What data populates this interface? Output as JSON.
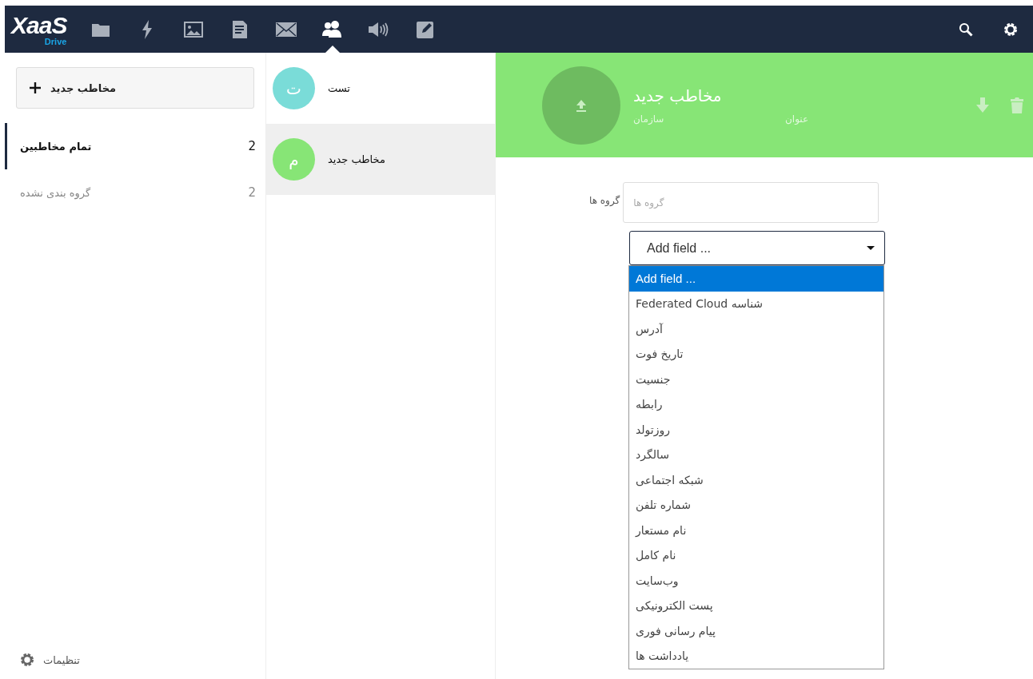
{
  "header": {
    "logo": "XaaS",
    "logo_sub": "Drive",
    "apps": [
      {
        "kind": "folder",
        "selected": false
      },
      {
        "kind": "activity",
        "selected": false
      },
      {
        "kind": "gallery",
        "selected": false
      },
      {
        "kind": "document",
        "selected": false
      },
      {
        "kind": "mail",
        "selected": false
      },
      {
        "kind": "contacts",
        "selected": true
      },
      {
        "kind": "audio",
        "selected": false
      },
      {
        "kind": "notes",
        "selected": false
      }
    ],
    "actions": [
      {
        "kind": "search"
      },
      {
        "kind": "settings"
      }
    ]
  },
  "sidebar": {
    "new_button": "مخاطب جدید",
    "groups": [
      {
        "label": "تمام مخاطبین",
        "count": "2",
        "selected": true
      },
      {
        "label": "گروه بندی نشده",
        "count": "2",
        "selected": false
      }
    ],
    "settings": "تنظیمات"
  },
  "contacts": [
    {
      "initial": "ت",
      "name": "تست",
      "color": "#7adcd8",
      "selected": false
    },
    {
      "initial": "م",
      "name": "مخاطب جدید",
      "color": "#87e576",
      "selected": true
    }
  ],
  "details": {
    "color": "#87e576",
    "name": "مخاطب جدید",
    "title_placeholder": "عنوان",
    "org_placeholder": "سازمان",
    "groups_label": "گروه ها",
    "groups_placeholder": "گروه ها",
    "add_field": "Add field ...",
    "options": [
      {
        "label": "Add field ...",
        "selected": true
      },
      {
        "label": "Federated Cloud شناسه",
        "selected": false
      },
      {
        "label": "آدرس",
        "selected": false
      },
      {
        "label": "تاریخ فوت",
        "selected": false
      },
      {
        "label": "جنسیت",
        "selected": false
      },
      {
        "label": "رابطه",
        "selected": false
      },
      {
        "label": "روزتولد",
        "selected": false
      },
      {
        "label": "سالگرد",
        "selected": false
      },
      {
        "label": "شبکه اجتماعی",
        "selected": false
      },
      {
        "label": "شماره تلفن",
        "selected": false
      },
      {
        "label": "نام مستعار",
        "selected": false
      },
      {
        "label": "نام کامل",
        "selected": false
      },
      {
        "label": "وب‌سایت",
        "selected": false
      },
      {
        "label": "پست الکترونیکی",
        "selected": false
      },
      {
        "label": "پیام رسانی فوری",
        "selected": false
      },
      {
        "label": "یادداشت ها",
        "selected": false
      }
    ]
  }
}
